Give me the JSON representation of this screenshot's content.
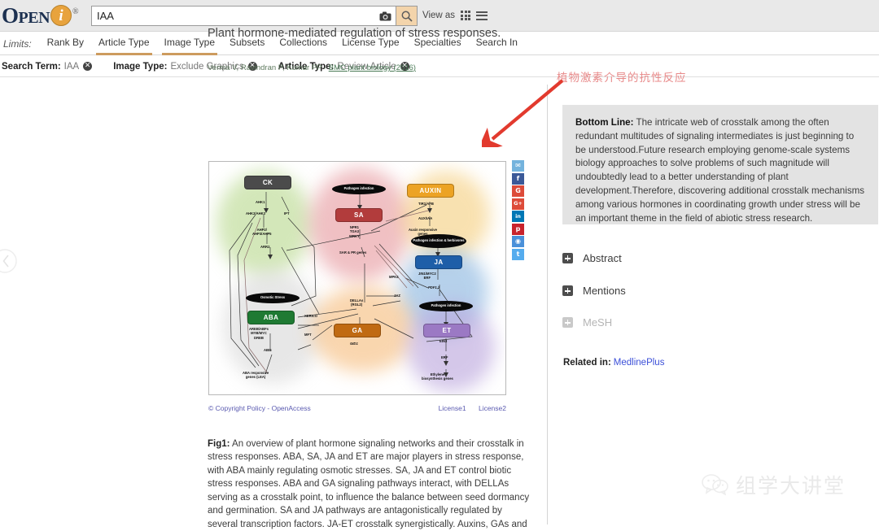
{
  "header": {
    "logo_word_a": "O",
    "logo_word_b": "PEN",
    "logo_i": "i",
    "logo_reg": "®",
    "search_value": "IAA",
    "search_placeholder": "Search Open-i",
    "camera_icon": "camera-icon",
    "search_icon": "magnifier-icon",
    "view_as_label": "View as",
    "grid_icon": "grid-view-icon",
    "list_icon": "list-view-icon"
  },
  "limits": {
    "label": "Limits:",
    "tabs": [
      {
        "label": "Rank By",
        "active": false
      },
      {
        "label": "Article Type",
        "active": true
      },
      {
        "label": "Image Type",
        "active": true
      },
      {
        "label": "Subsets",
        "active": false
      },
      {
        "label": "Collections",
        "active": false
      },
      {
        "label": "License Type",
        "active": false
      },
      {
        "label": "Specialties",
        "active": false
      },
      {
        "label": "Search In",
        "active": false
      }
    ]
  },
  "filters": [
    {
      "key": "Search Term:",
      "value": "IAA"
    },
    {
      "key": "Image Type:",
      "value": "Exclude Graphics"
    },
    {
      "key": "Article Type:",
      "value": "Review Article"
    }
  ],
  "article": {
    "title": "Plant hormone-mediated regulation of stress responses.",
    "authors": "Verma V, Ravindran P, Kumar PP - ",
    "journal_link": "BMC plant biology  (2016)"
  },
  "figure": {
    "copyright": "© Copyright Policy - OpenAccess",
    "license1": "License1",
    "license2": "License2",
    "caption_label": "Fig1:",
    "caption": " An overview of plant hormone signaling networks and their crosstalk in stress responses. ABA, SA, JA and ET are major players in stress response, with ABA mainly regulating osmotic stresses. SA, JA and ET control biotic stress responses. ABA and GA signaling pathways interact, with DELLAs serving as a crosstalk point, to influence the balance between seed dormancy and germination. SA and JA pathways are antagonistically regulated by several transcription factors. JA-ET crosstalk synergistically. Auxins, GAs and"
  },
  "diagram": {
    "hormones": [
      {
        "name": "CK",
        "color": "#4b4b4b"
      },
      {
        "name": "SA",
        "color": "#b23c3c"
      },
      {
        "name": "AUXIN",
        "color": "#eca324"
      },
      {
        "name": "JA",
        "color": "#1e5ea8"
      },
      {
        "name": "ABA",
        "color": "#1f7a33"
      },
      {
        "name": "GA",
        "color": "#c06a12"
      },
      {
        "name": "ET",
        "color": "#9b79c4"
      }
    ],
    "stimuli": [
      "Pathogen infection",
      "Pathogen infection\n& herbivores",
      "Pathogen infection",
      "Osmotic Stress"
    ],
    "gene_labels": [
      "AHK1",
      "AHK2/AHK3",
      "IPT",
      "AHP2/\nAHP3/AHP5",
      "ARR2",
      "NPR1\nTGA3\nWRKY",
      "SAR & PR genes",
      "TIR1/AFB",
      "AUX/IAA",
      "Auxin responsive\ngenes",
      "JIN1/MYC2\nERF",
      "PDF1,2",
      "MPK4",
      "JAZ",
      "AREB/ABFs\nMYB/MYC\nDREB",
      "ABI5",
      "ABA responsive\ngenes (LEA)",
      "XERICO",
      "MFT",
      "DELLAs\n(RGL2)",
      "GID1",
      "EIN3",
      "ERF",
      "Ethylene\nbiosynthesis genes"
    ]
  },
  "social": [
    {
      "name": "email-share-icon",
      "glyph": "✉",
      "color": "#74b3dd"
    },
    {
      "name": "facebook-share-icon",
      "glyph": "f",
      "color": "#3b5998"
    },
    {
      "name": "google-share-icon",
      "glyph": "G",
      "color": "#dd4b39"
    },
    {
      "name": "googleplus-share-icon",
      "glyph": "G+",
      "color": "#dd4b39"
    },
    {
      "name": "linkedin-share-icon",
      "glyph": "in",
      "color": "#0077b5"
    },
    {
      "name": "pinterest-share-icon",
      "glyph": "p",
      "color": "#c8232c"
    },
    {
      "name": "reddit-share-icon",
      "glyph": "◉",
      "color": "#4a90d9"
    },
    {
      "name": "twitter-share-icon",
      "glyph": "t",
      "color": "#55acee"
    }
  ],
  "sidebar": {
    "bottom_line_label": "Bottom Line:",
    "bottom_line_text": " The intricate web of crosstalk among the often redundant multitudes of signaling intermediates is just beginning to be understood.Future research employing genome-scale systems biology approaches to solve problems of such magnitude will undoubtedly lead to a better understanding of plant development.Therefore, discovering additional crosstalk mechanisms among various hormones in coordinating growth under stress will be an important theme in the field of abiotic stress research.",
    "accordions": [
      {
        "label": "Abstract",
        "disabled": false
      },
      {
        "label": "Mentions",
        "disabled": false
      },
      {
        "label": "MeSH",
        "disabled": true
      }
    ],
    "related_label": "Related in:",
    "related_link": "MedlinePlus"
  },
  "annotations": {
    "chinese_note": "植物激素介导的抗性反应",
    "arrow_color": "#e23a2e",
    "watermark_text": "组学大讲堂",
    "prev_icon": "chevron-left-icon"
  }
}
